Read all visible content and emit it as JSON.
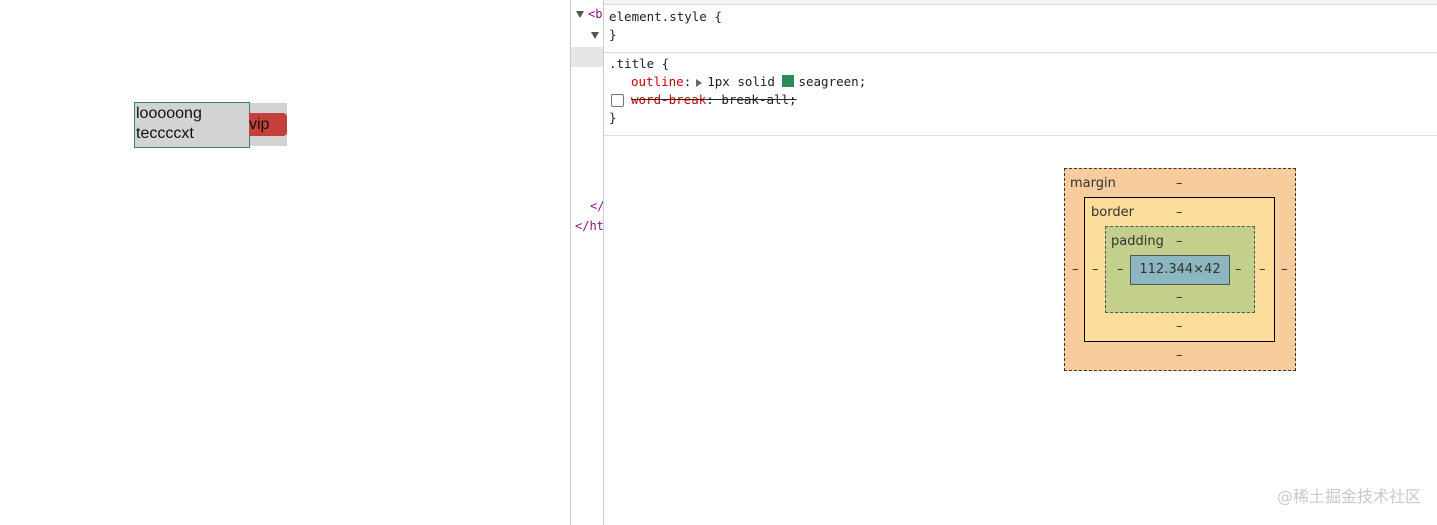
{
  "page": {
    "title_lines": [
      "looooong",
      "teccccxt"
    ],
    "vip_label": "vip"
  },
  "elements_tree": {
    "rows": [
      "<b",
      "</",
      "</ht"
    ]
  },
  "styles": {
    "element_style": {
      "selector": "element.style {",
      "close": "}"
    },
    "title_rule": {
      "selector": ".title {",
      "outline_name": "outline",
      "outline_value_pre": "1px solid",
      "outline_color_name": "seagreen",
      "outline_color": "#2e8b57",
      "wordbreak_name": "word-break",
      "wordbreak_value": "break-all;",
      "close": "}"
    }
  },
  "box_model": {
    "margin_label": "margin",
    "border_label": "border",
    "padding_label": "padding",
    "content_size": "112.344×42",
    "dash": "–"
  },
  "watermark": "@稀土掘金技术社区"
}
